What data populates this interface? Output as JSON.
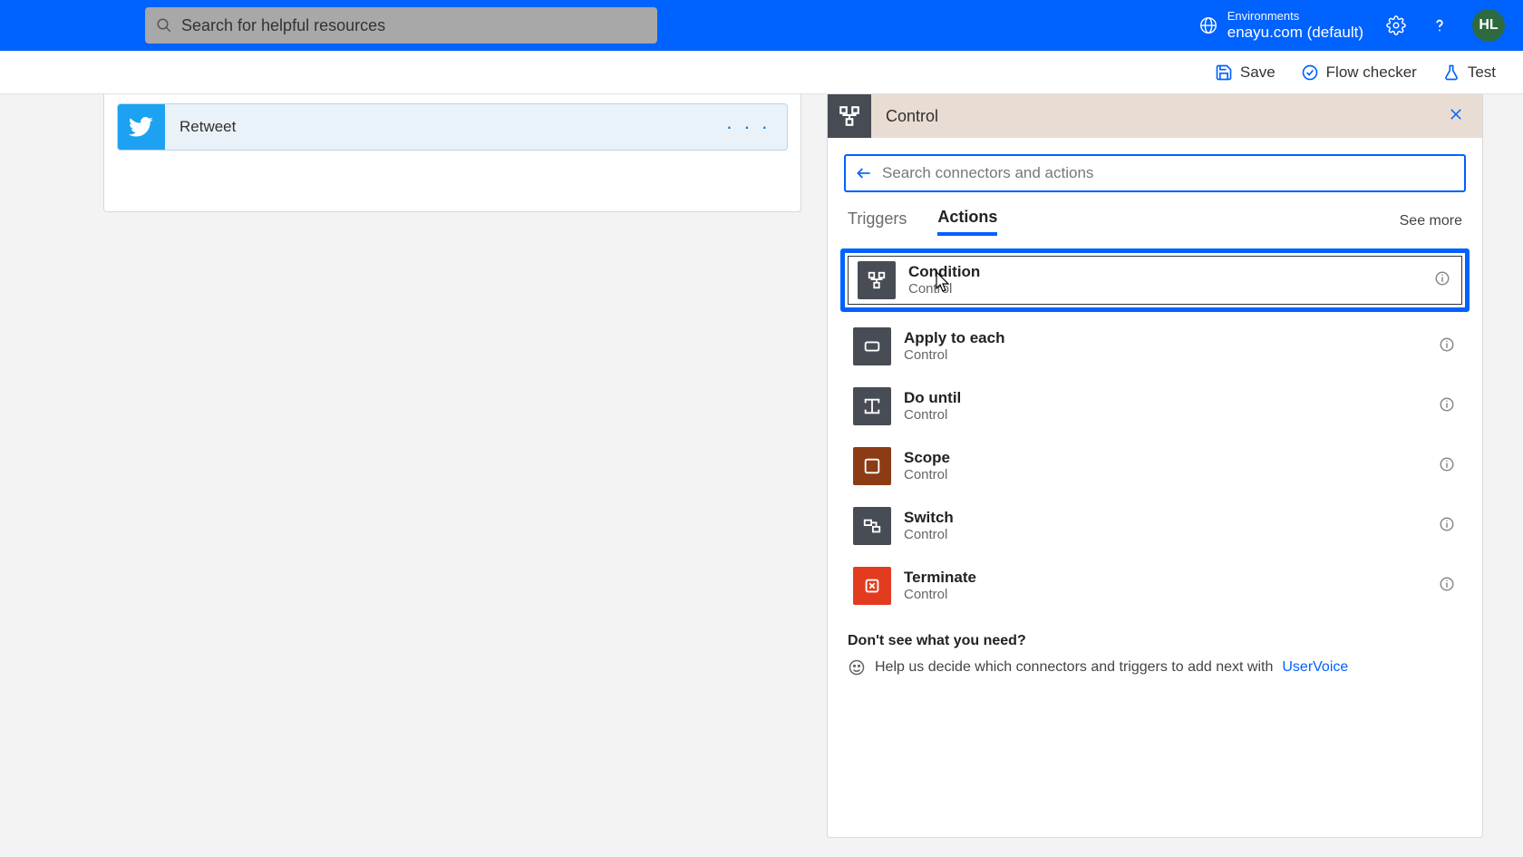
{
  "topbar": {
    "search_placeholder": "Search for helpful resources",
    "env_label": "Environments",
    "env_name": "enayu.com (default)",
    "avatar": "HL"
  },
  "cmdbar": {
    "save": "Save",
    "flow_checker": "Flow checker",
    "test": "Test"
  },
  "flow_step": {
    "label": "Retweet"
  },
  "panel": {
    "title": "Control",
    "search_placeholder": "Search connectors and actions",
    "tabs": {
      "triggers": "Triggers",
      "actions": "Actions"
    },
    "see_more": "See more",
    "actions": [
      {
        "title": "Condition",
        "sub": "Control",
        "icon": "gray",
        "highlight": true
      },
      {
        "title": "Apply to each",
        "sub": "Control",
        "icon": "gray",
        "highlight": false
      },
      {
        "title": "Do until",
        "sub": "Control",
        "icon": "gray",
        "highlight": false
      },
      {
        "title": "Scope",
        "sub": "Control",
        "icon": "brown",
        "highlight": false
      },
      {
        "title": "Switch",
        "sub": "Control",
        "icon": "gray",
        "highlight": false
      },
      {
        "title": "Terminate",
        "sub": "Control",
        "icon": "red",
        "highlight": false
      }
    ],
    "footer": {
      "title": "Don't see what you need?",
      "text": "Help us decide which connectors and triggers to add next with ",
      "link": "UserVoice"
    }
  }
}
